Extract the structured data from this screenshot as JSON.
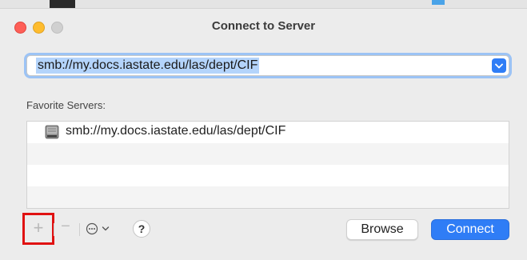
{
  "window": {
    "title": "Connect to Server"
  },
  "server_address": {
    "value": "smb://my.docs.iastate.edu/las/dept/CIF"
  },
  "favorites": {
    "label": "Favorite Servers:",
    "items": [
      {
        "address": "smb://my.docs.iastate.edu/las/dept/CIF",
        "icon": "server-drive-icon"
      }
    ]
  },
  "toolbar": {
    "add_label": "+",
    "remove_label": "−",
    "help_label": "?",
    "browse_label": "Browse",
    "connect_label": "Connect"
  },
  "colors": {
    "accent": "#2f7df6",
    "highlight_box": "#e01212"
  }
}
